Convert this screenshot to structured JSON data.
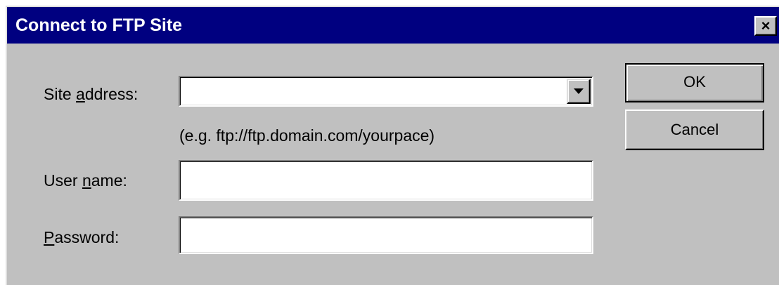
{
  "window": {
    "title": "Connect to FTP Site",
    "close_glyph": "×",
    "title_bar_color": "#000080",
    "face_color": "#c0c0c0"
  },
  "form": {
    "site_address": {
      "label_pre": "Site ",
      "label_accel": "a",
      "label_post": "ddress:",
      "value": "",
      "hint": "(e.g. ftp://ftp.domain.com/yourpace)",
      "dropdown_icon": "chevron-down-icon"
    },
    "user_name": {
      "label_pre": "User ",
      "label_accel": "n",
      "label_post": "ame:",
      "value": ""
    },
    "password": {
      "label_pre": "",
      "label_accel": "P",
      "label_post": "assword:",
      "value": ""
    }
  },
  "buttons": {
    "ok_label": "OK",
    "cancel_label": "Cancel"
  }
}
